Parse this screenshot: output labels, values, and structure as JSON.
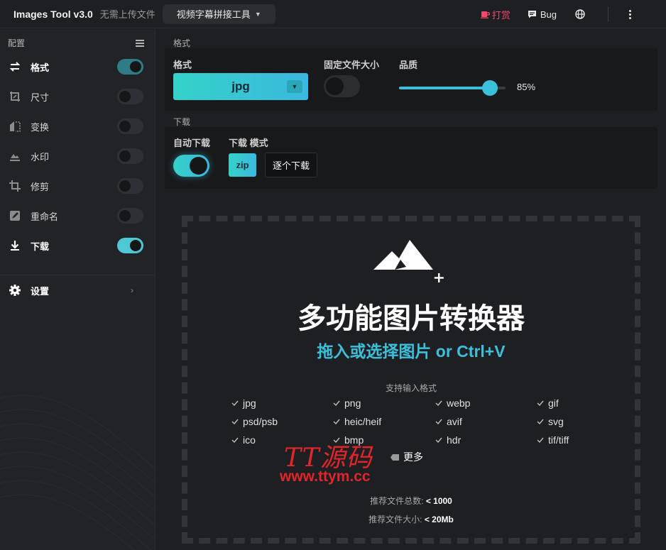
{
  "header": {
    "app_title": "Images Tool v3.0",
    "no_upload": "无需上传文件",
    "tool_select": "视频字幕拼接工具",
    "donate": "打赏",
    "bug": "Bug"
  },
  "sidebar": {
    "title": "配置",
    "items": [
      {
        "label": "格式",
        "enabled": true,
        "active": true,
        "icon": "swap-icon"
      },
      {
        "label": "尺寸",
        "enabled": false,
        "active": false,
        "icon": "resize-icon"
      },
      {
        "label": "变换",
        "enabled": false,
        "active": false,
        "icon": "transform-icon"
      },
      {
        "label": "水印",
        "enabled": false,
        "active": false,
        "icon": "watermark-icon"
      },
      {
        "label": "修剪",
        "enabled": false,
        "active": false,
        "icon": "crop-icon"
      },
      {
        "label": "重命名",
        "enabled": false,
        "active": false,
        "icon": "rename-icon"
      },
      {
        "label": "下载",
        "enabled": true,
        "active": true,
        "icon": "download-icon"
      }
    ],
    "settings_label": "设置"
  },
  "format_section": {
    "title": "格式",
    "format_label": "格式",
    "format_value": "jpg",
    "fixed_size_label": "固定文件大小",
    "fixed_size_enabled": false,
    "quality_label": "品质",
    "quality_value": 85,
    "quality_text": "85%"
  },
  "download_section": {
    "title": "下载",
    "auto_label": "自动下载",
    "auto_enabled": true,
    "mode_label": "下载 模式",
    "mode_zip": "zip",
    "mode_each": "逐个下载",
    "mode_selected": "zip"
  },
  "dropzone": {
    "title": "多功能图片转换器",
    "subtitle": "拖入或选择图片 or Ctrl+V",
    "supported_title": "支持输入格式",
    "formats": [
      "jpg",
      "png",
      "webp",
      "gif",
      "psd/psb",
      "heic/heif",
      "avif",
      "svg",
      "ico",
      "bmp",
      "hdr",
      "tif/tiff"
    ],
    "more": "更多",
    "rec_count_label": "推荐文件总数:",
    "rec_count_value": "< 1000",
    "rec_size_label": "推荐文件大小:",
    "rec_size_value": "< 20Mb"
  },
  "watermark": {
    "title": "TT源码",
    "url": "www.ttym.cc"
  },
  "colors": {
    "accent": "#3bc0dc",
    "accent_start": "#34d2c8",
    "background": "#1e1f22",
    "sidebar": "#222326",
    "panel": "#18191b",
    "donate": "#f04a6a",
    "watermark": "#e0262a"
  }
}
